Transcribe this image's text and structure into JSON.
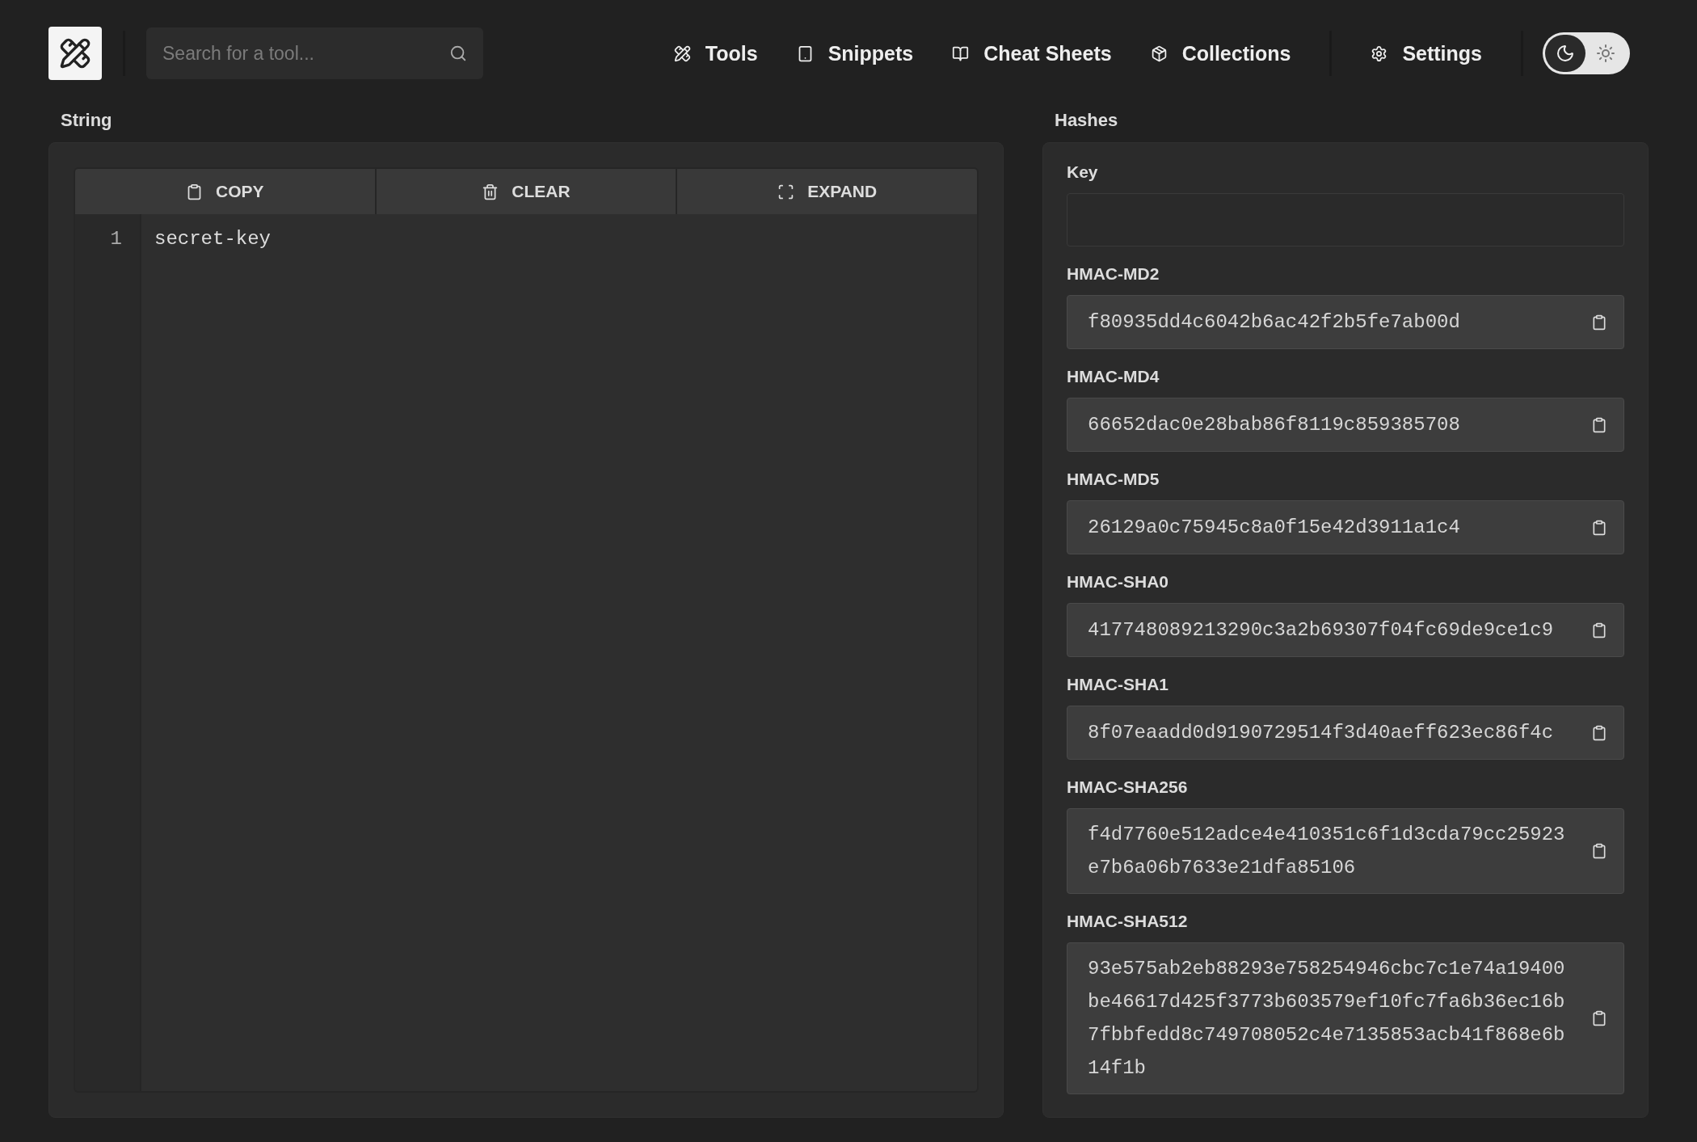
{
  "header": {
    "search": {
      "placeholder": "Search for a tool..."
    },
    "nav": [
      {
        "kind": "tools",
        "label": "Tools"
      },
      {
        "kind": "snippets",
        "label": "Snippets"
      },
      {
        "kind": "cheatsheets",
        "label": "Cheat Sheets"
      },
      {
        "kind": "collections",
        "label": "Collections"
      },
      {
        "kind": "settings",
        "label": "Settings"
      }
    ],
    "theme_toggle": [
      {
        "kind": "moon",
        "selected": true
      },
      {
        "kind": "sun",
        "selected": false
      }
    ]
  },
  "string_panel": {
    "title": "String",
    "toolbar": [
      {
        "kind": "copy",
        "label": "COPY"
      },
      {
        "kind": "clear",
        "label": "CLEAR"
      },
      {
        "kind": "expand",
        "label": "EXPAND"
      }
    ],
    "editor": {
      "lines": [
        {
          "number": "1",
          "text": "secret-key"
        }
      ]
    }
  },
  "hashes_panel": {
    "title": "Hashes",
    "key": {
      "label": "Key"
    },
    "hashes": [
      {
        "label": "HMAC-MD2",
        "value": "f80935dd4c6042b6ac42f2b5fe7ab00d"
      },
      {
        "label": "HMAC-MD4",
        "value": "66652dac0e28bab86f8119c859385708"
      },
      {
        "label": "HMAC-MD5",
        "value": "26129a0c75945c8a0f15e42d3911a1c4"
      },
      {
        "label": "HMAC-SHA0",
        "value": "417748089213290c3a2b69307f04fc69de9ce1c9"
      },
      {
        "label": "HMAC-SHA1",
        "value": "8f07eaadd0d9190729514f3d40aeff623ec86f4c"
      },
      {
        "label": "HMAC-SHA256",
        "value": "f4d7760e512adce4e410351c6f1d3cda79cc25923e7b6a06b7633e21dfa85106"
      },
      {
        "label": "HMAC-SHA512",
        "value": "93e575ab2eb88293e758254946cbc7c1e74a19400be46617d425f3773b603579ef10fc7fa6b36ec16b7fbbfedd8c749708052c4e7135853acb41f868e6b14f1b"
      }
    ]
  }
}
